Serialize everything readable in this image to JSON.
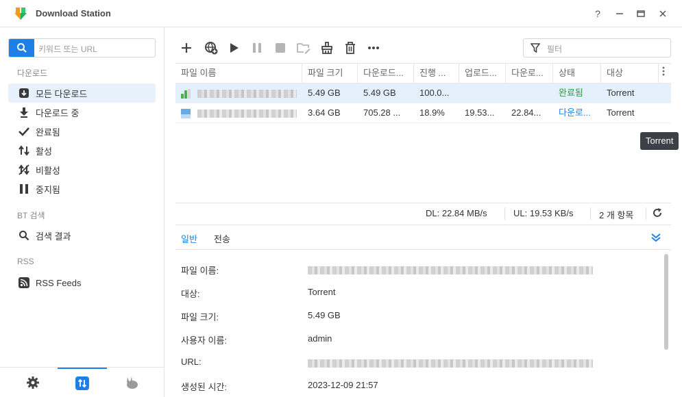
{
  "window": {
    "title": "Download Station",
    "help_label": "?",
    "minimize_label": "—",
    "maximize_label": "□",
    "close_label": "✕"
  },
  "sidebar": {
    "search_placeholder": "키워드 또는 URL",
    "sections": {
      "download": "다운로드",
      "bt_search": "BT 검색",
      "rss": "RSS"
    },
    "items": [
      {
        "label": "모든 다운로드",
        "icon": "download-all-icon",
        "active": true
      },
      {
        "label": "다운로드 중",
        "icon": "downloading-icon",
        "active": false
      },
      {
        "label": "완료됨",
        "icon": "check-icon",
        "active": false
      },
      {
        "label": "활성",
        "icon": "arrows-updown-icon",
        "active": false
      },
      {
        "label": "비활성",
        "icon": "inactive-icon",
        "active": false
      },
      {
        "label": "중지됨",
        "icon": "pause-icon",
        "active": false
      },
      {
        "label": "검색 결과",
        "icon": "search-icon",
        "active": false
      },
      {
        "label": "RSS Feeds",
        "icon": "rss-icon",
        "active": false
      }
    ]
  },
  "toolbar": {
    "filter_placeholder": "필터"
  },
  "grid": {
    "columns": [
      "파일 이름",
      "파일 크기",
      "다운로드...",
      "진행 ...",
      "업로드...",
      "다운로...",
      "상태",
      "대상"
    ],
    "rows": [
      {
        "size": "5.49 GB",
        "downloaded": "5.49 GB",
        "progress": "100.0...",
        "upload": "",
        "download_speed": "",
        "status": "완료됨",
        "destination": "Torrent"
      },
      {
        "size": "3.64 GB",
        "downloaded": "705.28 ...",
        "progress": "18.9%",
        "upload": "19.53...",
        "download_speed": "22.84...",
        "status": "다운로...",
        "destination": "Torrent"
      }
    ]
  },
  "tooltip": "Torrent",
  "statusbar": {
    "dl": "DL: 22.84 MB/s",
    "ul": "UL: 19.53 KB/s",
    "count": "2 개 항목"
  },
  "detail": {
    "tabs": [
      "일반",
      "전송"
    ],
    "fields": [
      {
        "label": "파일 이름:",
        "value": ""
      },
      {
        "label": "대상:",
        "value": "Torrent"
      },
      {
        "label": "파일 크기:",
        "value": "5.49 GB"
      },
      {
        "label": "사용자 이름:",
        "value": "admin"
      },
      {
        "label": "URL:",
        "value": ""
      },
      {
        "label": "생성된 시간:",
        "value": "2023-12-09 21:57"
      }
    ]
  },
  "colors": {
    "accent": "#1e7fe8",
    "complete": "#2b9a3a",
    "selected_row": "#e4f0fc"
  }
}
